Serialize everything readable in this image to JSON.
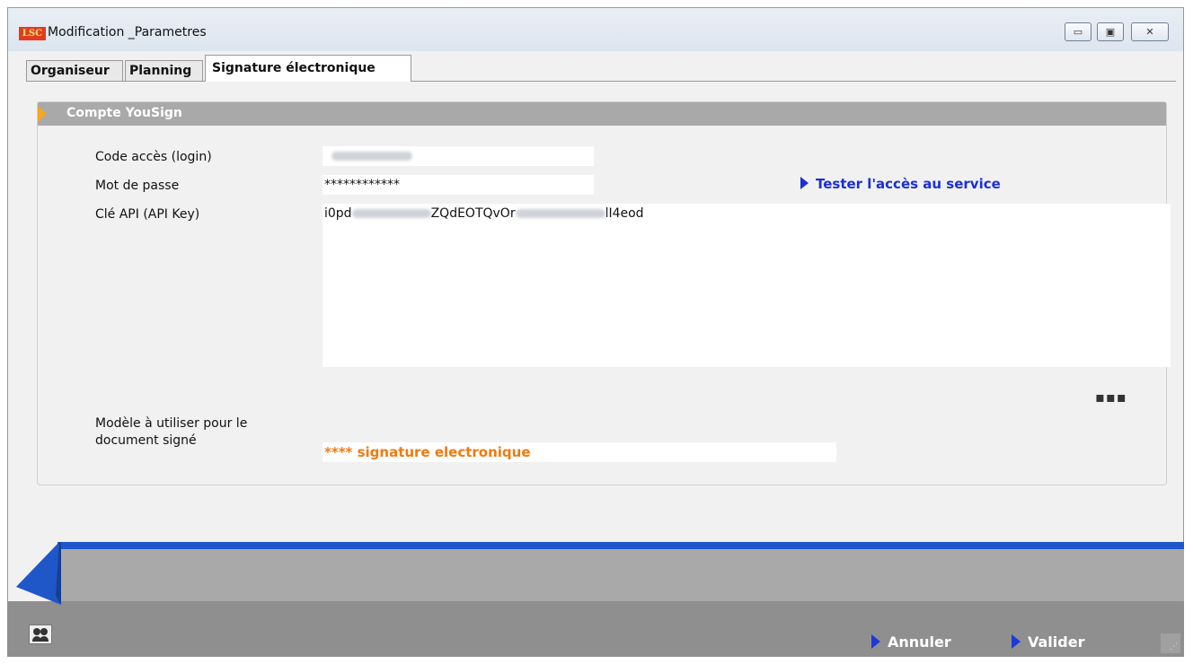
{
  "window": {
    "logo": "LSC",
    "title": "Modification _Parametres",
    "controls": {
      "minimize": "▭",
      "restore": "▣",
      "close": "✕"
    }
  },
  "tabs": [
    {
      "label": "Organiseur",
      "active": false
    },
    {
      "label": "Planning",
      "active": false
    },
    {
      "label": "Signature électronique",
      "active": true
    }
  ],
  "section": {
    "title": "Compte YouSign",
    "fields": {
      "login_label": "Code accès (login)",
      "password_label": "Mot de passe",
      "password_value": "************",
      "api_key_label": "Clé API (API Key)",
      "api_key_part1": "i0pd",
      "api_key_part2": "ZQdEOTQvOr",
      "api_key_part3": "lI4eod",
      "template_label_line1": "Modèle à utiliser pour le",
      "template_label_line2": "document signé",
      "template_value": "**** signature electronique"
    },
    "test_link": "Tester l'accès au service",
    "more_button": "▪▪▪"
  },
  "footer": {
    "cancel_label": "Annuler",
    "validate_label": "Valider"
  },
  "colors": {
    "accent_blue": "#1f57c9",
    "link_blue": "#1a2ed8",
    "orange": "#f07a10",
    "section_header": "#a9a9a9"
  }
}
